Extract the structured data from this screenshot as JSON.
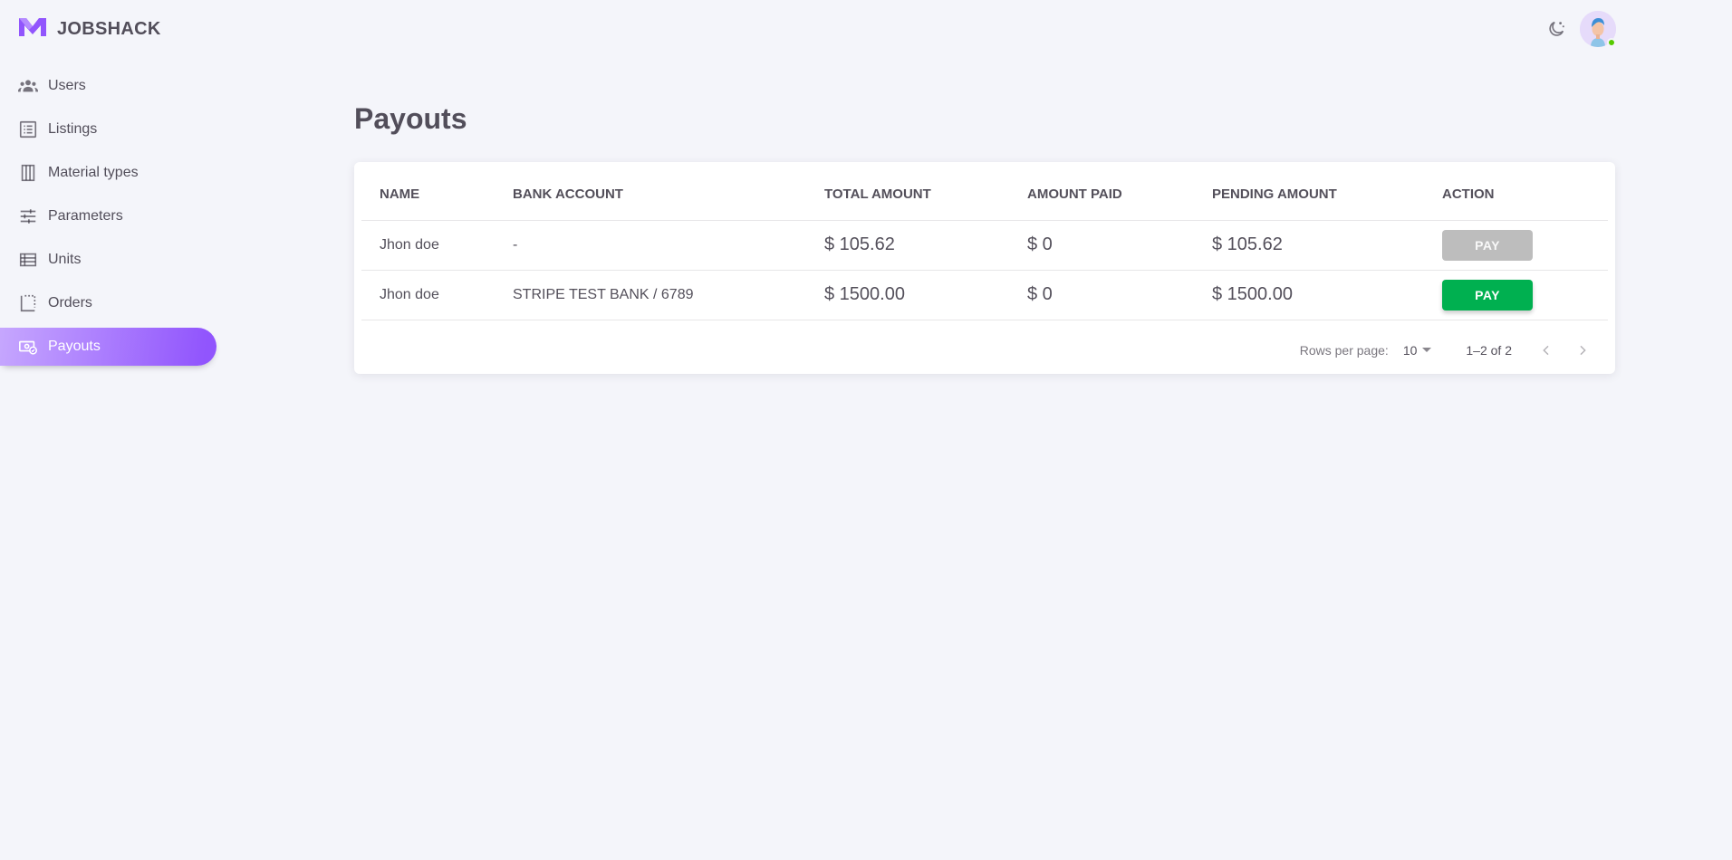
{
  "app": {
    "name": "JOBSHACK",
    "brand_color": "#9155fd"
  },
  "sidebar": {
    "items": [
      {
        "label": "Users",
        "icon": "users-icon"
      },
      {
        "label": "Listings",
        "icon": "list-icon"
      },
      {
        "label": "Material types",
        "icon": "columns-icon"
      },
      {
        "label": "Parameters",
        "icon": "tune-icon"
      },
      {
        "label": "Units",
        "icon": "table-rows-icon"
      },
      {
        "label": "Orders",
        "icon": "dotted-square-icon"
      },
      {
        "label": "Payouts",
        "icon": "cash-icon",
        "active": true
      }
    ]
  },
  "header": {
    "theme_icon": "moon-icon",
    "avatar": "user-avatar"
  },
  "main": {
    "title": "Payouts",
    "table": {
      "columns": [
        "Name",
        "Bank account",
        "Total amount",
        "Amount paid",
        "Pending amount",
        "Action"
      ],
      "rows": [
        {
          "name": "Jhon doe",
          "bank": "-",
          "total": "$ 105.62",
          "paid": "$ 0",
          "pending": "$ 105.62",
          "action": "PAY",
          "action_enabled": false
        },
        {
          "name": "Jhon doe",
          "bank": "STRIPE TEST BANK / 6789",
          "total": "$ 1500.00",
          "paid": "$ 0",
          "pending": "$ 1500.00",
          "action": "PAY",
          "action_enabled": true
        }
      ]
    },
    "pagination": {
      "rows_label": "Rows per page:",
      "rows_value": "10",
      "range": "1–2 of 2"
    }
  },
  "colors": {
    "pay_enabled": "#00b050",
    "pay_disabled": "#bdbdbd",
    "active_nav_start": "#c6a7fe",
    "active_nav_end": "#9155fd"
  }
}
